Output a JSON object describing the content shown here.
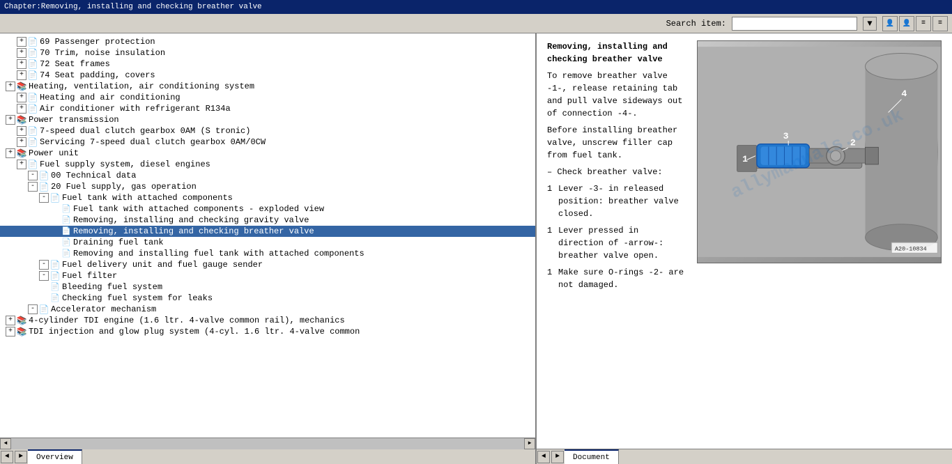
{
  "titleBar": {
    "text": "Chapter:Removing, installing and checking breather valve"
  },
  "toolbar": {
    "searchLabel": "Search item:",
    "searchPlaceholder": ""
  },
  "tree": {
    "items": [
      {
        "id": 1,
        "level": 1,
        "type": "expand-folder",
        "label": "69 Passenger protection"
      },
      {
        "id": 2,
        "level": 1,
        "type": "expand-folder",
        "label": "70 Trim, noise insulation"
      },
      {
        "id": 3,
        "level": 1,
        "type": "expand-folder",
        "label": "72 Seat frames"
      },
      {
        "id": 4,
        "level": 1,
        "type": "expand-folder",
        "label": "74 Seat padding, covers"
      },
      {
        "id": 5,
        "level": 0,
        "type": "expand-folder",
        "label": "Heating, ventilation, air conditioning system"
      },
      {
        "id": 6,
        "level": 1,
        "type": "expand-folder",
        "label": "Heating and air conditioning"
      },
      {
        "id": 7,
        "level": 1,
        "type": "expand-folder",
        "label": "Air conditioner with refrigerant R134a"
      },
      {
        "id": 8,
        "level": 0,
        "type": "expand-folder",
        "label": "Power transmission"
      },
      {
        "id": 9,
        "level": 1,
        "type": "expand-folder",
        "label": "7-speed dual clutch gearbox 0AM (S tronic)"
      },
      {
        "id": 10,
        "level": 1,
        "type": "expand-folder",
        "label": "Servicing 7-speed dual clutch gearbox 0AM/0CW"
      },
      {
        "id": 11,
        "level": 0,
        "type": "expand-folder",
        "label": "Power unit"
      },
      {
        "id": 12,
        "level": 1,
        "type": "expand-folder",
        "label": "Fuel supply system, diesel engines"
      },
      {
        "id": 13,
        "level": 2,
        "type": "expand-folder",
        "label": "00 Technical data"
      },
      {
        "id": 14,
        "level": 2,
        "type": "expand-folder",
        "label": "20 Fuel supply, gas operation"
      },
      {
        "id": 15,
        "level": 3,
        "type": "expand-folder",
        "label": "Fuel tank with attached components"
      },
      {
        "id": 16,
        "level": 4,
        "type": "doc",
        "label": "Fuel tank with attached components - exploded view"
      },
      {
        "id": 17,
        "level": 4,
        "type": "doc",
        "label": "Removing, installing and checking gravity valve"
      },
      {
        "id": 18,
        "level": 4,
        "type": "doc-selected",
        "label": "Removing, installing and checking breather valve"
      },
      {
        "id": 19,
        "level": 4,
        "type": "doc",
        "label": "Draining fuel tank"
      },
      {
        "id": 20,
        "level": 4,
        "type": "doc",
        "label": "Removing and installing fuel tank with attached components"
      },
      {
        "id": 21,
        "level": 3,
        "type": "expand-folder",
        "label": "Fuel delivery unit and fuel gauge sender"
      },
      {
        "id": 22,
        "level": 3,
        "type": "expand-folder",
        "label": "Fuel filter"
      },
      {
        "id": 23,
        "level": 3,
        "type": "doc",
        "label": "Bleeding fuel system"
      },
      {
        "id": 24,
        "level": 3,
        "type": "doc",
        "label": "Checking fuel system for leaks"
      },
      {
        "id": 25,
        "level": 2,
        "type": "expand-folder",
        "label": "Accelerator mechanism"
      },
      {
        "id": 26,
        "level": 0,
        "type": "expand-folder",
        "label": "4-cylinder TDI engine (1.6 ltr. 4-valve common rail), mechanics"
      },
      {
        "id": 27,
        "level": 0,
        "type": "expand-folder",
        "label": "TDI injection and glow plug system (4-cyl. 1.6 ltr. 4-valve common"
      }
    ]
  },
  "docContent": {
    "title": "Removing, installing and checking breather valve",
    "paragraphs": [
      {
        "bullet": false,
        "text": "To remove breather valve -1-, release retaining tab and pull valve sideways out of connection -4-."
      },
      {
        "bullet": false,
        "text": "Before installing breather valve, unscrew filler cap from fuel tank."
      },
      {
        "bullet": false,
        "text": "– Check breather valve:"
      },
      {
        "bullet": true,
        "text": "Lever -3- in released position: breather valve closed."
      },
      {
        "bullet": true,
        "text": "Lever pressed in direction of -arrow-: breather valve open."
      },
      {
        "bullet": true,
        "text": "Make sure O-rings -2- are not damaged."
      }
    ],
    "imageRef": "A20-10834",
    "imageLabels": [
      "1",
      "2",
      "3",
      "4"
    ],
    "watermark": "allymanuals.co.uk"
  },
  "bottomTabs": {
    "left": "Overview",
    "right": "Document"
  }
}
